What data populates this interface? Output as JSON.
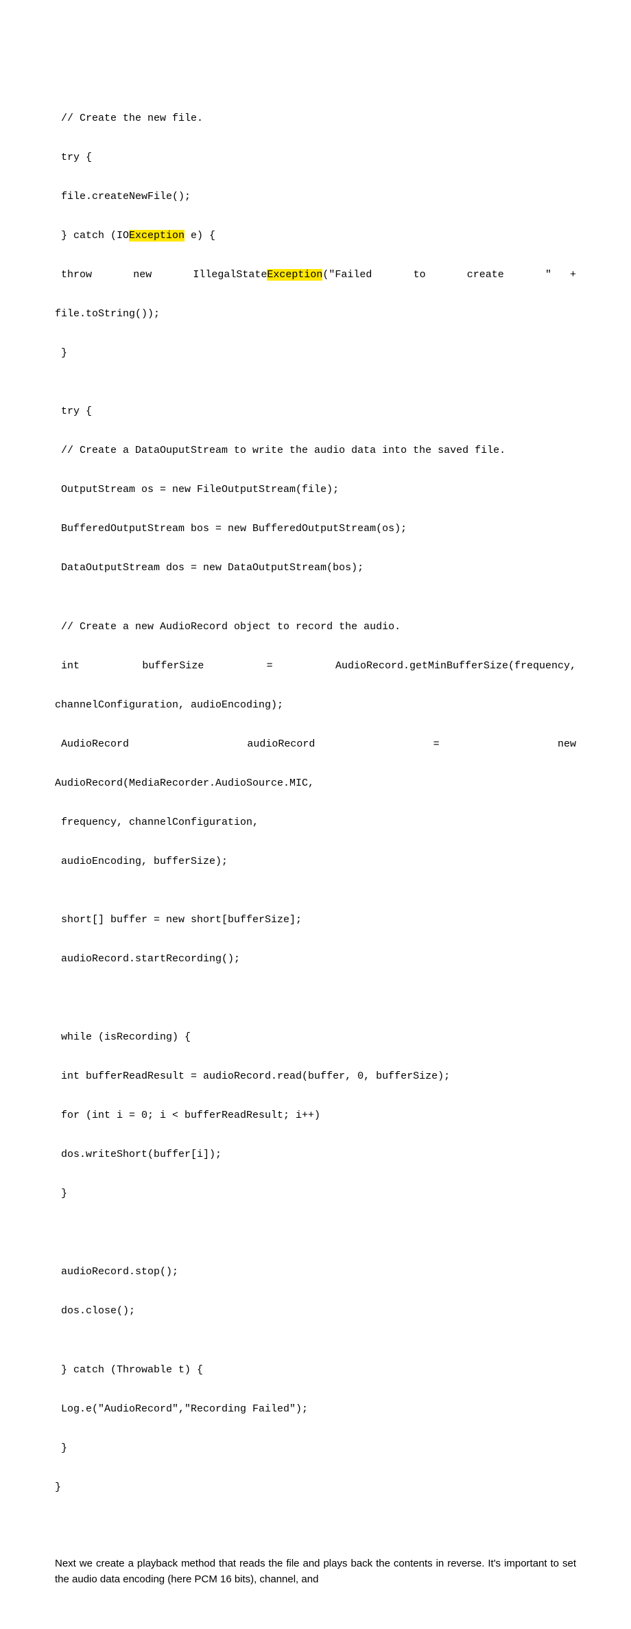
{
  "code": {
    "l1": " // Create the new file.",
    "l2": " try {",
    "l3": " file.createNewFile();",
    "l4a": " } catch (IO",
    "l4b": "Exception",
    "l4c": " e) {",
    "l5": {
      "w1": " throw",
      "w2": "new",
      "w3a": "IllegalState",
      "w3hl": "Exception",
      "w3b": "(\"Failed",
      "w4": "to",
      "w5": "create",
      "w6": "\"   +"
    },
    "l6": "file.toString());",
    "l7": " }",
    "l8": "",
    "l9": " try {",
    "l10": " // Create a DataOuputStream to write the audio data into the saved file.",
    "l11": " OutputStream os = new FileOutputStream(file);",
    "l12": " BufferedOutputStream bos = new BufferedOutputStream(os);",
    "l13": " DataOutputStream dos = new DataOutputStream(bos);",
    "l14": "",
    "l15": " // Create a new AudioRecord object to record the audio.",
    "l16": {
      "w1": " int",
      "w2": "bufferSize",
      "w3": "=",
      "w4": "AudioRecord.getMinBufferSize(frequency,"
    },
    "l17": "channelConfiguration, audioEncoding);",
    "l18": {
      "w1": " AudioRecord",
      "w2": "audioRecord",
      "w3": "=",
      "w4": "new"
    },
    "l19": "AudioRecord(MediaRecorder.AudioSource.MIC,",
    "l20": " frequency, channelConfiguration,",
    "l21": " audioEncoding, bufferSize);",
    "l22": "",
    "l23": " short[] buffer = new short[bufferSize];",
    "l24": " audioRecord.startRecording();",
    "l25": "",
    "l26": "",
    "l27": " while (isRecording) {",
    "l28": " int bufferReadResult = audioRecord.read(buffer, 0, bufferSize);",
    "l29": " for (int i = 0; i < bufferReadResult; i++)",
    "l30": " dos.writeShort(buffer[i]);",
    "l31": " }",
    "l32": "",
    "l33": "",
    "l34": " audioRecord.stop();",
    "l35": " dos.close();",
    "l36": "",
    "l37": " } catch (Throwable t) {",
    "l38": " Log.e(\"AudioRecord\",\"Recording Failed\");",
    "l39": " }",
    "l40": "}"
  },
  "paragraph": "Next we create a playback method that reads the file and plays back the contents in reverse. It's important to set the audio data encoding (here PCM 16 bits), channel, and"
}
